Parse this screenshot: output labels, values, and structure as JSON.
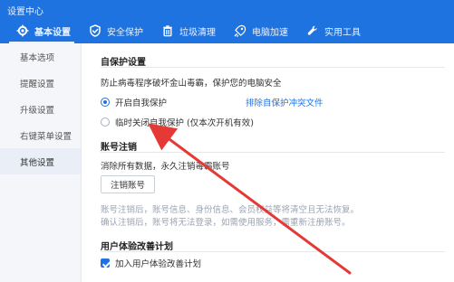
{
  "window": {
    "title": "设置中心"
  },
  "nav": {
    "tabs": [
      {
        "label": "基本设置",
        "icon": "gear-icon"
      },
      {
        "label": "安全保护",
        "icon": "shield-icon"
      },
      {
        "label": "垃圾清理",
        "icon": "trash-icon"
      },
      {
        "label": "电脑加速",
        "icon": "rocket-icon"
      },
      {
        "label": "实用工具",
        "icon": "wrench-icon"
      }
    ],
    "active_index": 0
  },
  "sidebar": {
    "items": [
      {
        "label": "基本选项"
      },
      {
        "label": "提醒设置"
      },
      {
        "label": "升级设置"
      },
      {
        "label": "右键菜单设置"
      },
      {
        "label": "其他设置"
      }
    ],
    "active_index": 4
  },
  "self_protect": {
    "title": "自保护设置",
    "description": "防止病毒程序破坏金山毒霸，保护您的电脑安全",
    "options": [
      {
        "label": "开启自我保护",
        "selected": true
      },
      {
        "label": "临时关闭自我保护 (仅本次开机有效)",
        "selected": false
      }
    ],
    "conflict_link": "排除自保护冲突文件"
  },
  "account_cancel": {
    "title": "账号注销",
    "description": "消除所有数据，永久注销毒霸账号",
    "button": "注销账号",
    "note_line1": "账号注销后，账号信息、身份信息、会员权益等将清空且无法恢复。",
    "note_line2": "确认注销后，账号将无法登录，如需使用服务，需重新注册账号。"
  },
  "ux_program": {
    "title": "用户体验改善计划",
    "checkbox_label": "加入用户体验改善计划",
    "checked": true
  },
  "colors": {
    "brand": "#1f73e0",
    "annotation_red": "#e53935"
  }
}
